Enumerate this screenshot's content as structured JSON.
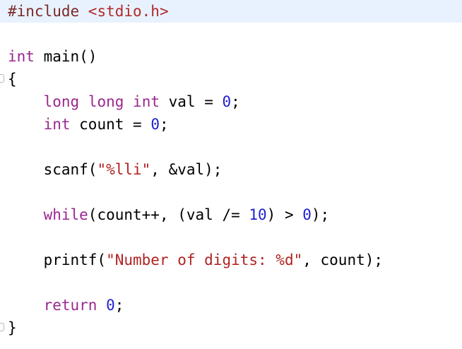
{
  "editor": {
    "lines": [
      {
        "tokens": [
          {
            "t": "#include ",
            "c": "pp"
          },
          {
            "t": "<stdio.h>",
            "c": "inc"
          }
        ]
      },
      {
        "tokens": []
      },
      {
        "tokens": [
          {
            "t": "int",
            "c": "kw2"
          },
          {
            "t": " main()",
            "c": ""
          }
        ]
      },
      {
        "tokens": [
          {
            "t": "{",
            "c": ""
          }
        ]
      },
      {
        "tokens": [
          {
            "t": "    ",
            "c": ""
          },
          {
            "t": "long",
            "c": "kw2"
          },
          {
            "t": " ",
            "c": ""
          },
          {
            "t": "long",
            "c": "kw2"
          },
          {
            "t": " ",
            "c": ""
          },
          {
            "t": "int",
            "c": "kw2"
          },
          {
            "t": " val = ",
            "c": ""
          },
          {
            "t": "0",
            "c": "num"
          },
          {
            "t": ";",
            "c": ""
          }
        ]
      },
      {
        "tokens": [
          {
            "t": "    ",
            "c": ""
          },
          {
            "t": "int",
            "c": "kw2"
          },
          {
            "t": " count = ",
            "c": ""
          },
          {
            "t": "0",
            "c": "num"
          },
          {
            "t": ";",
            "c": ""
          }
        ]
      },
      {
        "tokens": []
      },
      {
        "tokens": [
          {
            "t": "    scanf(",
            "c": ""
          },
          {
            "t": "\"%lli\"",
            "c": "str"
          },
          {
            "t": ", &val);",
            "c": ""
          }
        ]
      },
      {
        "tokens": []
      },
      {
        "tokens": [
          {
            "t": "    ",
            "c": ""
          },
          {
            "t": "while",
            "c": "kw2"
          },
          {
            "t": "(count++, (val /= ",
            "c": ""
          },
          {
            "t": "10",
            "c": "num"
          },
          {
            "t": ") > ",
            "c": ""
          },
          {
            "t": "0",
            "c": "num"
          },
          {
            "t": ");",
            "c": ""
          }
        ]
      },
      {
        "tokens": []
      },
      {
        "tokens": [
          {
            "t": "    printf(",
            "c": ""
          },
          {
            "t": "\"Number of digits: %d\"",
            "c": "str"
          },
          {
            "t": ", count);",
            "c": ""
          }
        ]
      },
      {
        "tokens": []
      },
      {
        "tokens": [
          {
            "t": "    ",
            "c": ""
          },
          {
            "t": "return",
            "c": "kw2"
          },
          {
            "t": " ",
            "c": ""
          },
          {
            "t": "0",
            "c": "num"
          },
          {
            "t": ";",
            "c": ""
          }
        ]
      },
      {
        "tokens": [
          {
            "t": "}",
            "c": ""
          }
        ]
      }
    ]
  },
  "colors": {
    "highlight_line": "#e8f2fe",
    "keyword": "#9a2790",
    "string": "#b22222",
    "number": "#1f1fd1",
    "preprocessor": "#7a2828"
  }
}
